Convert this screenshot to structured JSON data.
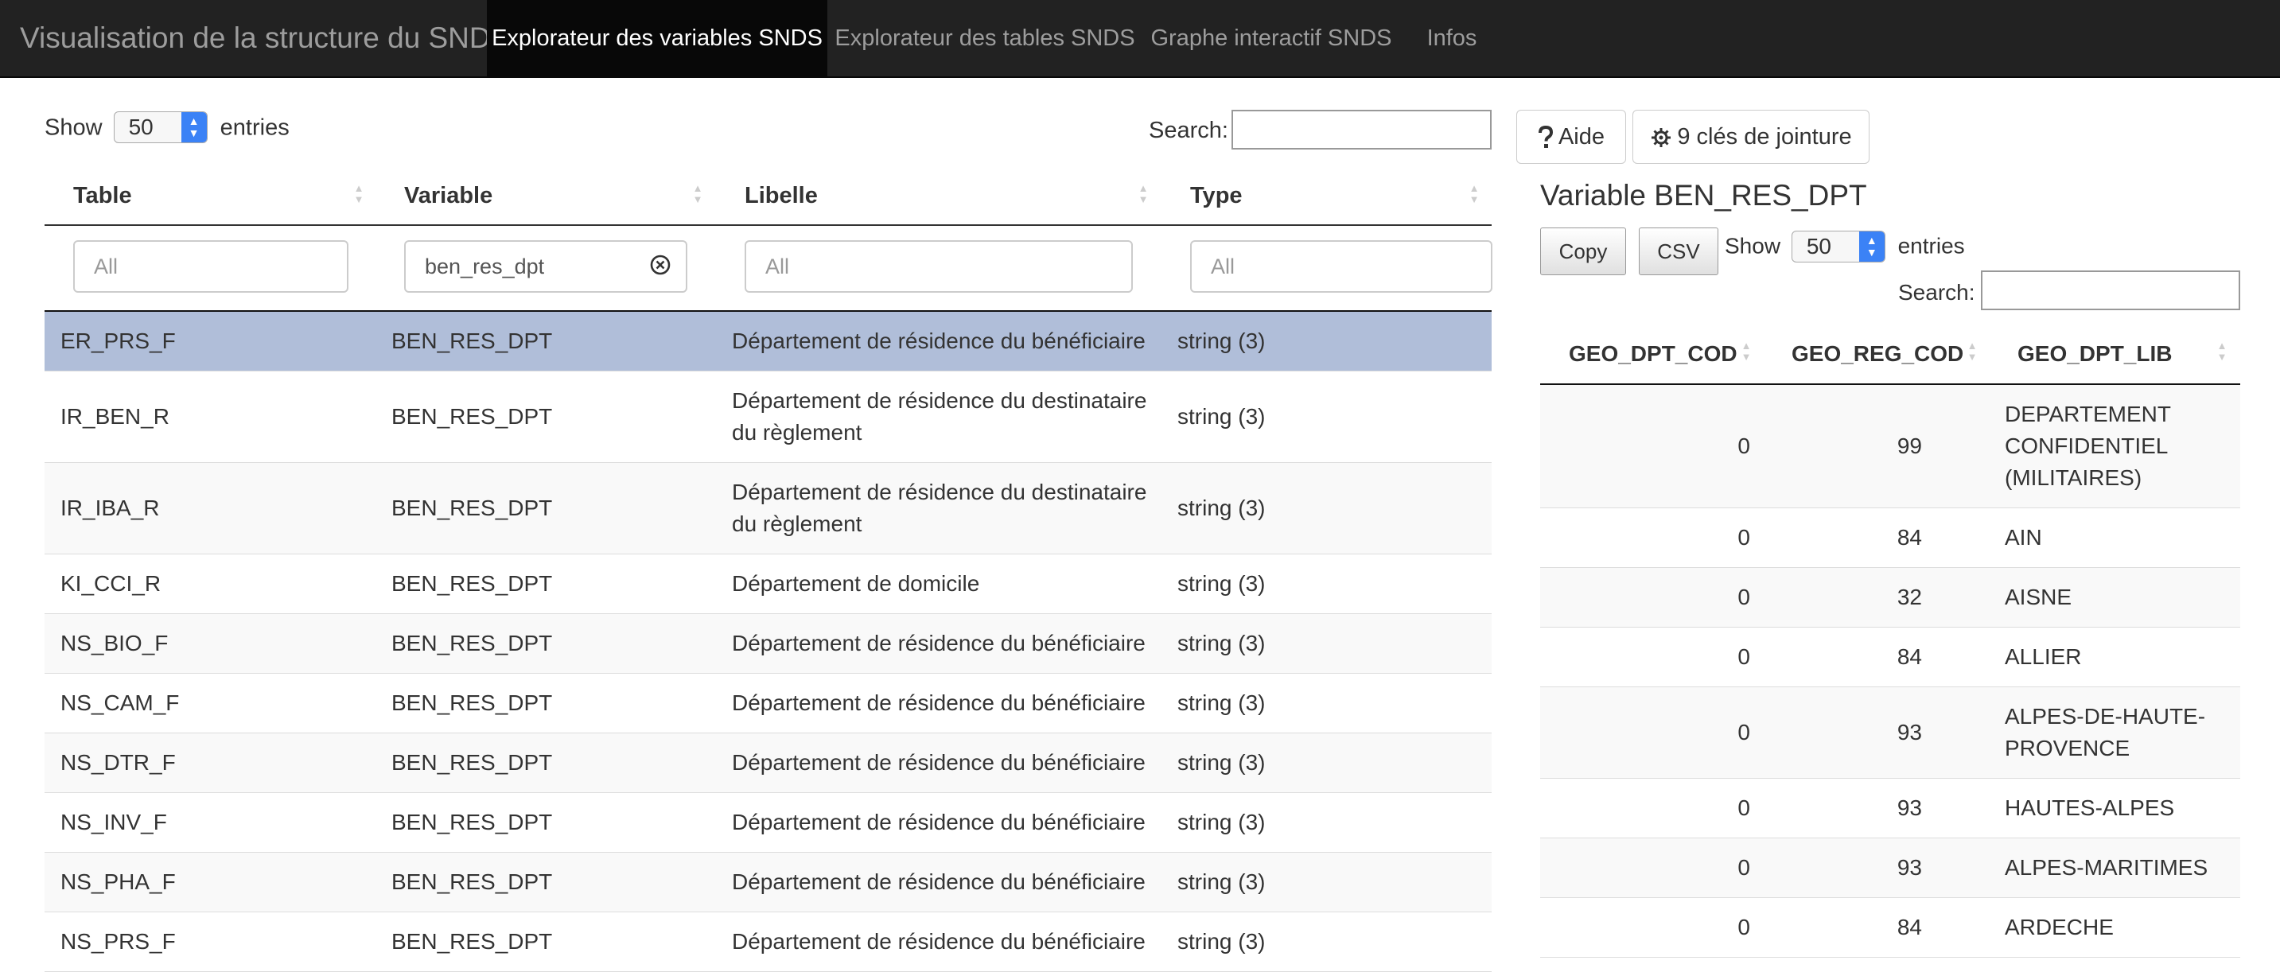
{
  "navbar": {
    "brand": "Visualisation de la structure du SNDS",
    "tabs": [
      {
        "label": "Explorateur des variables SNDS",
        "active": true
      },
      {
        "label": "Explorateur des tables SNDS",
        "active": false
      },
      {
        "label": "Graphe interactif SNDS",
        "active": false
      },
      {
        "label": "Infos",
        "active": false
      }
    ]
  },
  "left": {
    "show_label": "Show",
    "entries_value": "50",
    "entries_label": "entries",
    "search_label": "Search:",
    "search_value": "",
    "columns": [
      "Table",
      "Variable",
      "Libelle",
      "Type"
    ],
    "filters": [
      {
        "placeholder": "All",
        "value": ""
      },
      {
        "placeholder": "All",
        "value": "ben_res_dpt"
      },
      {
        "placeholder": "All",
        "value": ""
      },
      {
        "placeholder": "All",
        "value": ""
      }
    ],
    "rows": [
      {
        "table": "ER_PRS_F",
        "variable": "BEN_RES_DPT",
        "libelle": "Département de résidence du bénéficiaire",
        "type": "string (3)",
        "selected": true
      },
      {
        "table": "IR_BEN_R",
        "variable": "BEN_RES_DPT",
        "libelle": "Département de résidence du destinataire du règlement",
        "type": "string (3)",
        "selected": false
      },
      {
        "table": "IR_IBA_R",
        "variable": "BEN_RES_DPT",
        "libelle": "Département de résidence du destinataire du règlement",
        "type": "string (3)",
        "selected": false
      },
      {
        "table": "KI_CCI_R",
        "variable": "BEN_RES_DPT",
        "libelle": "Département de domicile",
        "type": "string (3)",
        "selected": false
      },
      {
        "table": "NS_BIO_F",
        "variable": "BEN_RES_DPT",
        "libelle": "Département de résidence du bénéficiaire",
        "type": "string (3)",
        "selected": false
      },
      {
        "table": "NS_CAM_F",
        "variable": "BEN_RES_DPT",
        "libelle": "Département de résidence du bénéficiaire",
        "type": "string (3)",
        "selected": false
      },
      {
        "table": "NS_DTR_F",
        "variable": "BEN_RES_DPT",
        "libelle": "Département de résidence du bénéficiaire",
        "type": "string (3)",
        "selected": false
      },
      {
        "table": "NS_INV_F",
        "variable": "BEN_RES_DPT",
        "libelle": "Département de résidence du bénéficiaire",
        "type": "string (3)",
        "selected": false
      },
      {
        "table": "NS_PHA_F",
        "variable": "BEN_RES_DPT",
        "libelle": "Département de résidence du bénéficiaire",
        "type": "string (3)",
        "selected": false
      },
      {
        "table": "NS_PRS_F",
        "variable": "BEN_RES_DPT",
        "libelle": "Département de résidence du bénéficiaire",
        "type": "string (3)",
        "selected": false
      }
    ]
  },
  "right": {
    "aide_label": "Aide",
    "keys_label": "9 clés de jointure",
    "title": "Variable BEN_RES_DPT",
    "copy_label": "Copy",
    "csv_label": "CSV",
    "show_label": "Show",
    "entries_value": "50",
    "entries_label": "entries",
    "search_label": "Search:",
    "search_value": "",
    "columns": [
      "GEO_DPT_COD",
      "GEO_REG_COD",
      "GEO_DPT_LIB"
    ],
    "rows": [
      {
        "dpt_cod": "0",
        "reg_cod": "99",
        "dpt_lib": "DEPARTEMENT CONFIDENTIEL (MILITAIRES)"
      },
      {
        "dpt_cod": "0",
        "reg_cod": "84",
        "dpt_lib": "AIN"
      },
      {
        "dpt_cod": "0",
        "reg_cod": "32",
        "dpt_lib": "AISNE"
      },
      {
        "dpt_cod": "0",
        "reg_cod": "84",
        "dpt_lib": "ALLIER"
      },
      {
        "dpt_cod": "0",
        "reg_cod": "93",
        "dpt_lib": "ALPES-DE-HAUTE-PROVENCE"
      },
      {
        "dpt_cod": "0",
        "reg_cod": "93",
        "dpt_lib": "HAUTES-ALPES"
      },
      {
        "dpt_cod": "0",
        "reg_cod": "93",
        "dpt_lib": "ALPES-MARITIMES"
      },
      {
        "dpt_cod": "0",
        "reg_cod": "84",
        "dpt_lib": "ARDECHE"
      }
    ]
  },
  "icons": {
    "sort": "sort-both-icon",
    "clear": "circle-x-icon",
    "help": "question-mark-icon",
    "keys": "gear-icon"
  }
}
